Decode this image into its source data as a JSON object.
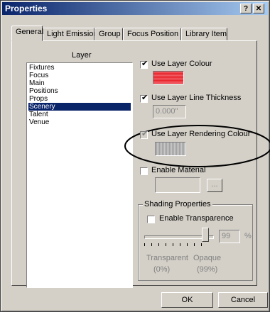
{
  "window": {
    "title": "Properties",
    "help_glyph": "?",
    "close_glyph": "✕"
  },
  "tabs": [
    {
      "label": "General",
      "active": true
    },
    {
      "label": "Light Emission"
    },
    {
      "label": "Group"
    },
    {
      "label": "Focus Position"
    },
    {
      "label": "Library Item"
    }
  ],
  "layer": {
    "label": "Layer",
    "items": [
      "Fixtures",
      "Focus",
      "Main",
      "Positions",
      "Props",
      "Scenery",
      "Talent",
      "Venue"
    ],
    "selected": "Scenery"
  },
  "options": {
    "use_layer_colour": {
      "label": "Use Layer Colour",
      "checked": true,
      "swatch_color": "#e8262e"
    },
    "use_layer_line_thickness": {
      "label": "Use Layer Line Thickness",
      "checked": true,
      "value": "0.000\""
    },
    "use_layer_rendering_colour": {
      "label": "Use Layer Rendering Colour",
      "checked": true,
      "disabled": true,
      "swatch_color": "#c8c8c8"
    },
    "enable_material": {
      "label": "Enable Material",
      "checked": false,
      "browse_label": "..."
    }
  },
  "shading": {
    "title": "Shading Properties",
    "enable_transparence": {
      "label": "Enable Transparence",
      "checked": false
    },
    "slider_value_percent": 99,
    "value": "99",
    "unit": "%",
    "left_label": "Transparent",
    "right_label": "Opaque",
    "left_value": "(0%)",
    "right_value": "(99%)"
  },
  "buttons": {
    "ok": "OK",
    "cancel": "Cancel"
  },
  "colors": {
    "title_start": "#0a246a",
    "title_end": "#a6caf0",
    "selection": "#0a246a",
    "face": "#d4d0c8"
  }
}
